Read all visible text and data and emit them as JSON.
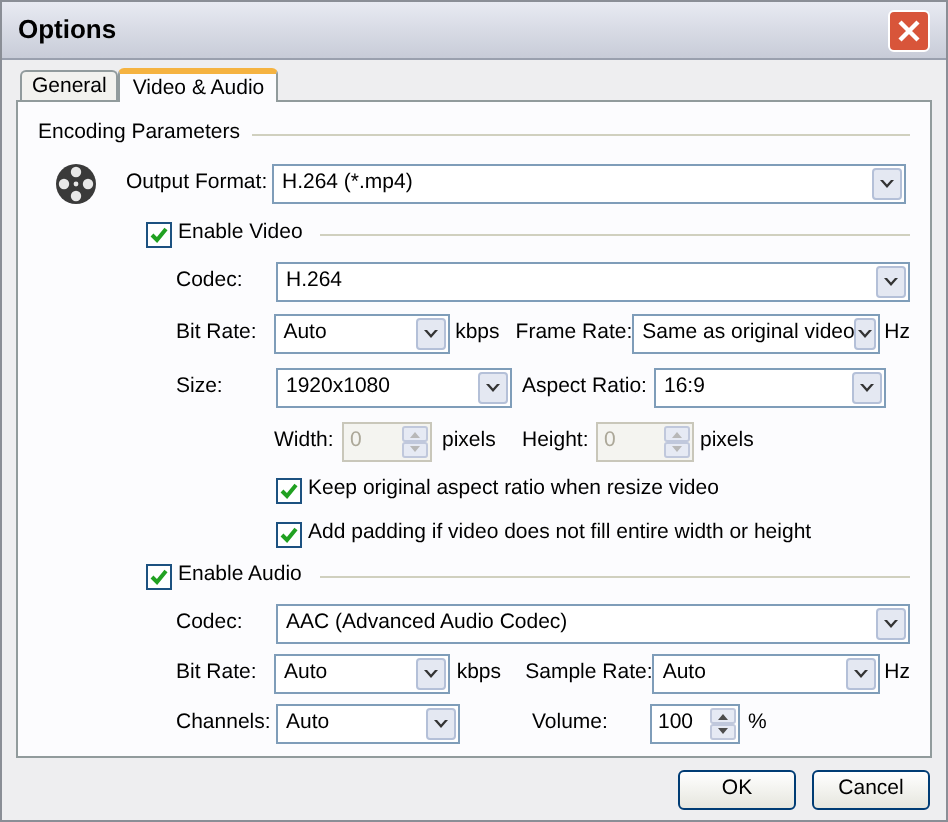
{
  "window": {
    "title": "Options"
  },
  "tabs": [
    {
      "label": "General",
      "selected": false
    },
    {
      "label": "Video & Audio",
      "selected": true
    }
  ],
  "group_title": "Encoding Parameters",
  "output_format": {
    "label": "Output Format:",
    "value": "H.264 (*.mp4)"
  },
  "video": {
    "label": "Enable Video",
    "checked": true,
    "codec": {
      "label": "Codec:",
      "value": "H.264"
    },
    "bit_rate": {
      "label": "Bit Rate:",
      "value": "Auto",
      "unit": "kbps"
    },
    "frame_rate": {
      "label": "Frame Rate:",
      "value": "Same as original video",
      "unit": "Hz"
    },
    "size": {
      "label": "Size:",
      "value": "1920x1080"
    },
    "aspect_ratio": {
      "label": "Aspect Ratio:",
      "value": "16:9"
    },
    "width": {
      "label": "Width:",
      "value": "0",
      "unit": "pixels",
      "disabled": true
    },
    "height": {
      "label": "Height:",
      "value": "0",
      "unit": "pixels",
      "disabled": true
    },
    "options": [
      {
        "label": "Keep original aspect ratio when resize video",
        "checked": true
      },
      {
        "label": "Add padding if video does not fill entire width or height",
        "checked": true
      }
    ]
  },
  "audio": {
    "label": "Enable Audio",
    "checked": true,
    "codec": {
      "label": "Codec:",
      "value": "AAC (Advanced Audio Codec)"
    },
    "bit_rate": {
      "label": "Bit Rate:",
      "value": "Auto",
      "unit": "kbps"
    },
    "sample_rate": {
      "label": "Sample Rate:",
      "value": "Auto",
      "unit": "Hz"
    },
    "channels": {
      "label": "Channels:",
      "value": "Auto"
    },
    "volume": {
      "label": "Volume:",
      "value": "100",
      "unit": "%",
      "disabled": false
    }
  },
  "buttons": [
    "OK",
    "Cancel"
  ]
}
